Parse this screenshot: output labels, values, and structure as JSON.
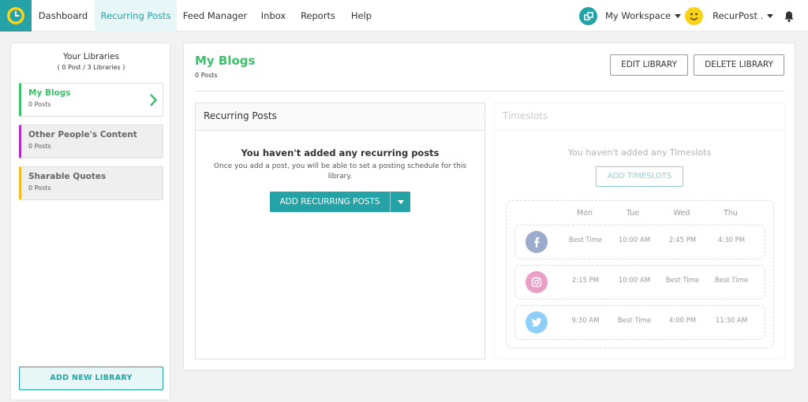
{
  "topnav": {
    "items": [
      "Dashboard",
      "Recurring Posts",
      "Feed Manager",
      "Inbox",
      "Reports",
      "Help"
    ],
    "active_index": 1,
    "workspace_label": "My Workspace",
    "user_label": "RecurPost .",
    "accent": "#24a2a6"
  },
  "sidebar": {
    "title": "Your Libraries",
    "subtitle": "( 0 Post / 3 Libraries )",
    "libraries": [
      {
        "name": "My Blogs",
        "count": "0 Posts",
        "color": "#3fbf6c",
        "active": true
      },
      {
        "name": "Other People's Content",
        "count": "0 Posts",
        "color": "#b02cc2",
        "active": false
      },
      {
        "name": "Sharable Quotes",
        "count": "0 Posts",
        "color": "#f2bd1c",
        "active": false
      }
    ],
    "add_button": "ADD NEW LIBRARY"
  },
  "main": {
    "title": "My Blogs",
    "post_count": "0 Posts",
    "edit_button": "EDIT LIBRARY",
    "delete_button": "DELETE LIBRARY",
    "recurring": {
      "heading": "Recurring Posts",
      "empty_title": "You haven't added any recurring posts",
      "empty_text": "Once you add a post, you will be able to set a posting schedule for this library.",
      "button": "ADD RECURRING POSTS"
    },
    "timeslots": {
      "heading": "Timeslots",
      "empty_text": "You haven't added any Timeslots",
      "button": "ADD TIMESLOTS",
      "days": [
        "Mon",
        "Tue",
        "Wed",
        "Thu"
      ],
      "rows": [
        {
          "network": "facebook-icon",
          "color": "#3b5998",
          "slots": [
            "Best Time",
            "10:00 AM",
            "2:45 PM",
            "4:30 PM"
          ]
        },
        {
          "network": "instagram-icon",
          "color": "#d6428f",
          "slots": [
            "2:15 PM",
            "10:00 AM",
            "Best Time",
            "Best Time"
          ]
        },
        {
          "network": "twitter-icon",
          "color": "#1da1f2",
          "slots": [
            "9:30 AM",
            "Best Time",
            "4:00 PM",
            "11:30 AM"
          ]
        }
      ]
    }
  }
}
